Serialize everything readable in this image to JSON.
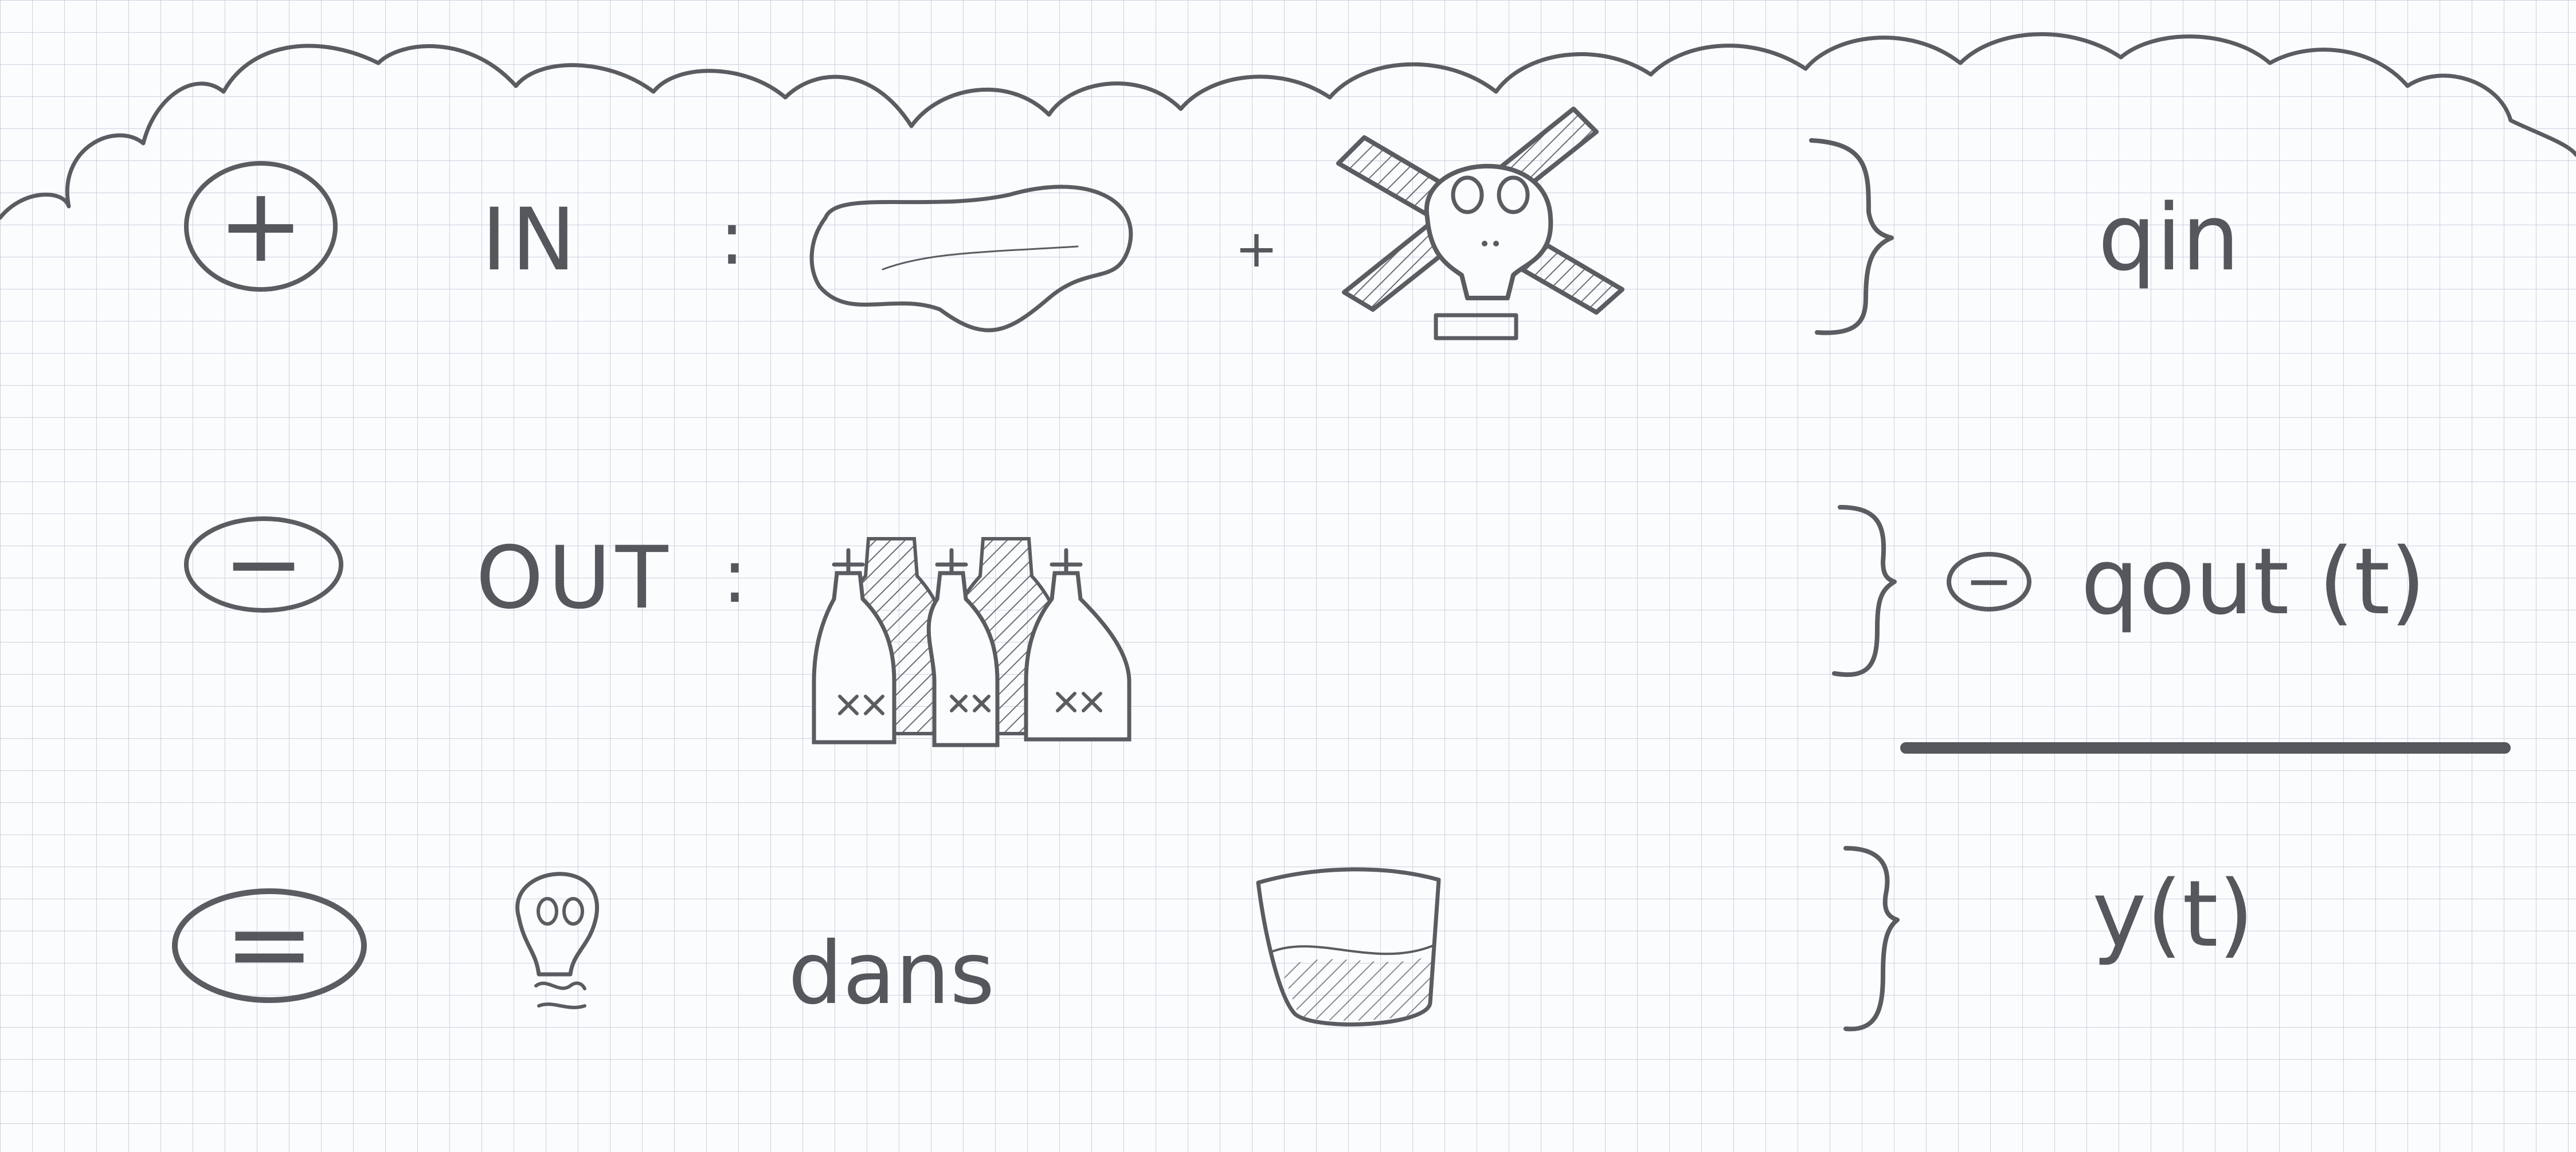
{
  "rows": [
    {
      "sign": "+",
      "label": "IN",
      "colon": ":",
      "plus": "+",
      "result": "qin",
      "icons": [
        "puddle-icon",
        "skull-crossbones-icon"
      ]
    },
    {
      "sign": "−",
      "label": "OUT",
      "colon": ":",
      "result_sign": "−",
      "result": "qout (t)",
      "icons": [
        "poison-bottles-icon"
      ]
    },
    {
      "sign": "=",
      "word": "dans",
      "result": "y(t)",
      "icons": [
        "small-skull-icon",
        "basin-icon"
      ]
    }
  ],
  "colors": {
    "ink": "#5a5c61",
    "grid": "#c9d3df",
    "paper": "#fbfcfe"
  }
}
